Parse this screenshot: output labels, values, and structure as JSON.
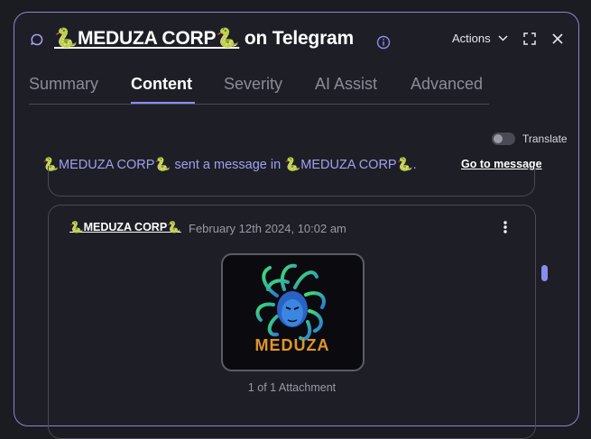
{
  "header": {
    "channel_name": "🐍MEDUZA CORP🐍",
    "title_suffix": " on Telegram",
    "actions_label": "Actions"
  },
  "tabs": [
    {
      "label": "Summary",
      "active": false
    },
    {
      "label": "Content",
      "active": true
    },
    {
      "label": "Severity",
      "active": false
    },
    {
      "label": "AI Assist",
      "active": false
    },
    {
      "label": "Advanced",
      "active": false
    }
  ],
  "translate": {
    "label": "Translate",
    "enabled": false
  },
  "context": {
    "text": "🐍MEDUZA CORP🐍 sent a message in 🐍MEDUZA CORP🐍.",
    "goto_label": "Go to message"
  },
  "message": {
    "sender": "🐍MEDUZA CORP🐍",
    "timestamp": "February 12th 2024, 10:02 am",
    "attachment_count": "1 of 1 Attachment"
  },
  "attachment_image": {
    "caption": "MEDUZA"
  },
  "colors": {
    "accent": "#8f8cf0",
    "link": "#9ea2ee",
    "logo_text": "#e0952a"
  }
}
